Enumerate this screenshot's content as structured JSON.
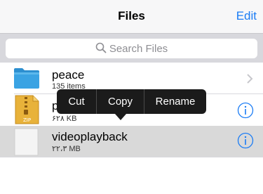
{
  "navbar": {
    "title": "Files",
    "edit_label": "Edit"
  },
  "search": {
    "placeholder": "Search Files"
  },
  "files": [
    {
      "name": "peace",
      "detail": "135 items",
      "kind": "folder-icon",
      "accessory": "chevron-right-icon"
    },
    {
      "name": "p",
      "detail": "۶۲۸ KB",
      "kind": "zip-icon",
      "accessory": "info-icon"
    },
    {
      "name": "videoplayback",
      "detail": "۲۲،۳ MB",
      "kind": "document-icon",
      "accessory": "info-icon",
      "selected": true
    }
  ],
  "context_menu": {
    "items": [
      "Cut",
      "Copy",
      "Rename"
    ]
  },
  "colors": {
    "accent": "#1a7cf5",
    "callout": "#1b1b1b",
    "selection": "#d9d9d9",
    "folder": "#3aa3e3"
  }
}
